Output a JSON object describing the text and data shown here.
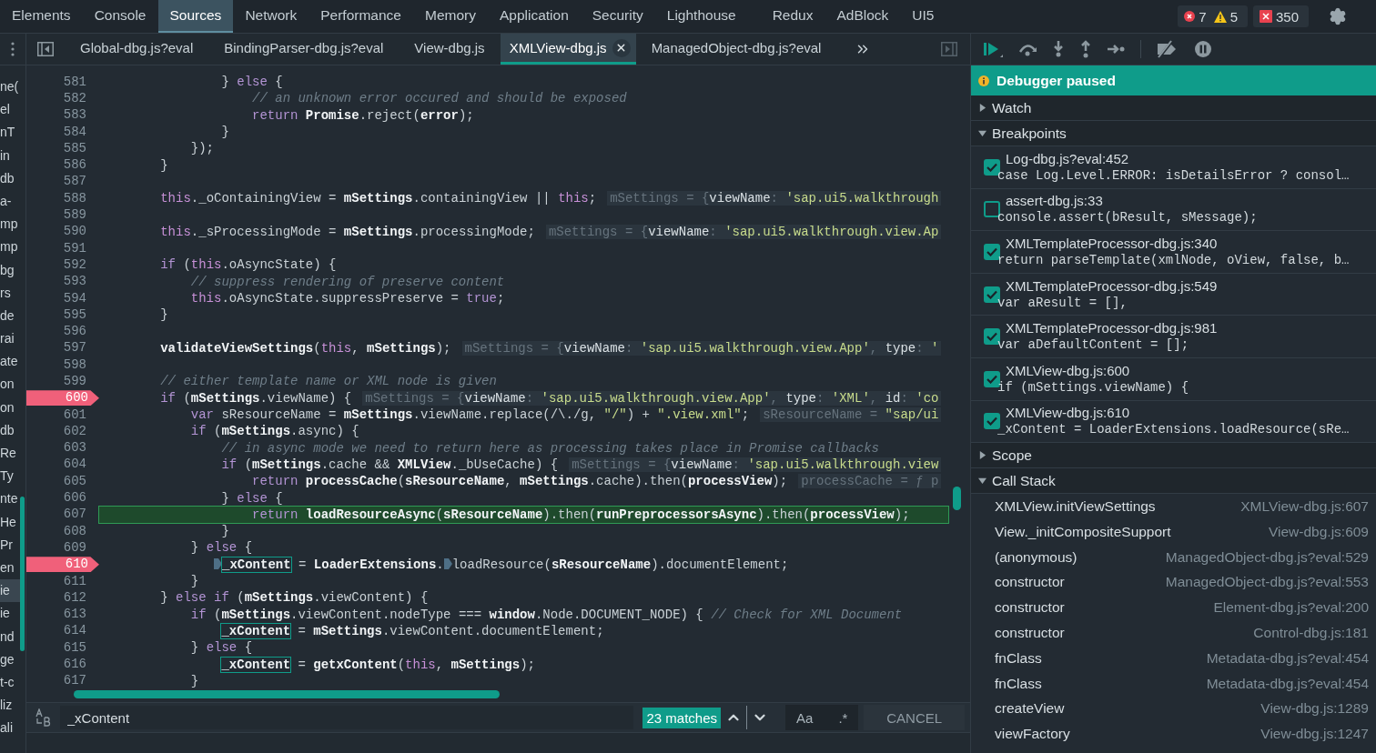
{
  "devtools_tabs": [
    {
      "label": "Elements",
      "selected": false
    },
    {
      "label": "Console",
      "selected": false
    },
    {
      "label": "Sources",
      "selected": true
    },
    {
      "label": "Network",
      "selected": false
    },
    {
      "label": "Performance",
      "selected": false
    },
    {
      "label": "Memory",
      "selected": false
    },
    {
      "label": "Application",
      "selected": false
    },
    {
      "label": "Security",
      "selected": false
    },
    {
      "label": "Lighthouse",
      "selected": false
    },
    {
      "label": "Redux",
      "selected": false
    },
    {
      "label": "AdBlock",
      "selected": false
    },
    {
      "label": "UI5",
      "selected": false
    }
  ],
  "counters": [
    {
      "kind": "error",
      "count": "7"
    },
    {
      "kind": "warning",
      "count": "5"
    },
    {
      "kind": "issue",
      "count": "350"
    }
  ],
  "file_tree": [
    {
      "label": "ne(",
      "selected": false
    },
    {
      "label": "el",
      "selected": false
    },
    {
      "label": "nT",
      "selected": false
    },
    {
      "label": "in",
      "selected": false
    },
    {
      "label": "db",
      "selected": false
    },
    {
      "label": "a-",
      "selected": false
    },
    {
      "label": "mp",
      "selected": false
    },
    {
      "label": "mp",
      "selected": false
    },
    {
      "label": "bg",
      "selected": false
    },
    {
      "label": "rs",
      "selected": false
    },
    {
      "label": "de",
      "selected": false
    },
    {
      "label": "rai",
      "selected": false
    },
    {
      "label": "ate",
      "selected": false
    },
    {
      "label": "on",
      "selected": false
    },
    {
      "label": "on",
      "selected": false
    },
    {
      "label": "db",
      "selected": false
    },
    {
      "label": "Re",
      "selected": false
    },
    {
      "label": "Ty",
      "selected": false
    },
    {
      "label": "nte",
      "selected": false
    },
    {
      "label": "He",
      "selected": false
    },
    {
      "label": "Pr",
      "selected": false
    },
    {
      "label": "en",
      "selected": false
    },
    {
      "label": "ie",
      "selected": true
    },
    {
      "label": "ie",
      "selected": false
    },
    {
      "label": "nd",
      "selected": false
    },
    {
      "label": "ge",
      "selected": false
    },
    {
      "label": "t-c",
      "selected": false
    },
    {
      "label": "liz",
      "selected": false
    },
    {
      "label": "ali",
      "selected": false
    }
  ],
  "editor_tabs": [
    {
      "label": "Global-dbg.js?eval",
      "selected": false
    },
    {
      "label": "BindingParser-dbg.js?eval",
      "selected": false
    },
    {
      "label": "View-dbg.js",
      "selected": false
    },
    {
      "label": "XMLView-dbg.js",
      "selected": true
    },
    {
      "label": "ManagedObject-dbg.js?eval",
      "selected": false
    }
  ],
  "code": {
    "lines": [
      {
        "number": "581",
        "breakpoint": false,
        "current": false,
        "tokens": [
          {
            "kind": "plain",
            "text": "                } "
          },
          {
            "kind": "kw",
            "text": "else"
          },
          {
            "kind": "plain",
            "text": " {"
          }
        ]
      },
      {
        "number": "582",
        "breakpoint": false,
        "current": false,
        "tokens": [
          {
            "kind": "cmt",
            "text": "                    // an unknown error occured and should be exposed"
          }
        ]
      },
      {
        "number": "583",
        "breakpoint": false,
        "current": false,
        "tokens": [
          {
            "kind": "kw",
            "text": "                    return"
          },
          {
            "kind": "bold",
            "text": " Promise"
          },
          {
            "kind": "plain",
            "text": ".reject("
          },
          {
            "kind": "bold",
            "text": "error"
          },
          {
            "kind": "plain",
            "text": ");"
          }
        ]
      },
      {
        "number": "584",
        "breakpoint": false,
        "current": false,
        "tokens": [
          {
            "kind": "plain",
            "text": "                }"
          }
        ]
      },
      {
        "number": "585",
        "breakpoint": false,
        "current": false,
        "tokens": [
          {
            "kind": "plain",
            "text": "            });"
          }
        ]
      },
      {
        "number": "586",
        "breakpoint": false,
        "current": false,
        "tokens": [
          {
            "kind": "plain",
            "text": "        }"
          }
        ]
      },
      {
        "number": "587",
        "breakpoint": false,
        "current": false
      },
      {
        "number": "588",
        "breakpoint": false,
        "current": false,
        "tokens": [
          {
            "kind": "this",
            "text": "        this"
          },
          {
            "kind": "plain",
            "text": "._oContainingView = "
          },
          {
            "kind": "bold",
            "text": "mSettings"
          },
          {
            "kind": "plain",
            "text": ".containingView || "
          },
          {
            "kind": "this",
            "text": "this"
          },
          {
            "kind": "plain",
            "text": ";"
          },
          {
            "kind": "hint",
            "text": "mSettings = {"
          },
          {
            "kind": "hkey",
            "text": "viewName"
          },
          {
            "kind": "hint",
            "text": ": "
          },
          {
            "kind": "hstr",
            "text": "'sap.ui5.walkthrough"
          }
        ]
      },
      {
        "number": "589",
        "breakpoint": false,
        "current": false
      },
      {
        "number": "590",
        "breakpoint": false,
        "current": false,
        "tokens": [
          {
            "kind": "this",
            "text": "        this"
          },
          {
            "kind": "plain",
            "text": "._sProcessingMode = "
          },
          {
            "kind": "bold",
            "text": "mSettings"
          },
          {
            "kind": "plain",
            "text": ".processingMode;"
          },
          {
            "kind": "hint",
            "text": "mSettings = {"
          },
          {
            "kind": "hkey",
            "text": "viewName"
          },
          {
            "kind": "hint",
            "text": ": "
          },
          {
            "kind": "hstr",
            "text": "'sap.ui5.walkthrough.view.Ap"
          }
        ]
      },
      {
        "number": "591",
        "breakpoint": false,
        "current": false
      },
      {
        "number": "592",
        "breakpoint": false,
        "current": false,
        "tokens": [
          {
            "kind": "kw",
            "text": "        if"
          },
          {
            "kind": "plain",
            "text": " ("
          },
          {
            "kind": "this",
            "text": "this"
          },
          {
            "kind": "plain",
            "text": ".oAsyncState) {"
          }
        ]
      },
      {
        "number": "593",
        "breakpoint": false,
        "current": false,
        "tokens": [
          {
            "kind": "cmt",
            "text": "            // suppress rendering of preserve content"
          }
        ]
      },
      {
        "number": "594",
        "breakpoint": false,
        "current": false,
        "tokens": [
          {
            "kind": "this",
            "text": "            this"
          },
          {
            "kind": "plain",
            "text": ".oAsyncState.suppressPreserve = "
          },
          {
            "kind": "kw",
            "text": "true"
          },
          {
            "kind": "plain",
            "text": ";"
          }
        ]
      },
      {
        "number": "595",
        "breakpoint": false,
        "current": false,
        "tokens": [
          {
            "kind": "plain",
            "text": "        }"
          }
        ]
      },
      {
        "number": "596",
        "breakpoint": false,
        "current": false
      },
      {
        "number": "597",
        "breakpoint": false,
        "current": false,
        "tokens": [
          {
            "kind": "bold",
            "text": "        validateViewSettings"
          },
          {
            "kind": "plain",
            "text": "("
          },
          {
            "kind": "this",
            "text": "this"
          },
          {
            "kind": "plain",
            "text": ", "
          },
          {
            "kind": "bold",
            "text": "mSettings"
          },
          {
            "kind": "plain",
            "text": ");"
          },
          {
            "kind": "hint",
            "text": "mSettings = {"
          },
          {
            "kind": "hkey",
            "text": "viewName"
          },
          {
            "kind": "hint",
            "text": ": "
          },
          {
            "kind": "hstr",
            "text": "'sap.ui5.walkthrough.view.App'"
          },
          {
            "kind": "hint",
            "text": ", "
          },
          {
            "kind": "hkey",
            "text": "type"
          },
          {
            "kind": "hint",
            "text": ": "
          },
          {
            "kind": "hstr",
            "text": "'"
          }
        ]
      },
      {
        "number": "598",
        "breakpoint": false,
        "current": false
      },
      {
        "number": "599",
        "breakpoint": false,
        "current": false,
        "tokens": [
          {
            "kind": "cmt",
            "text": "        // either template name or XML node is given"
          }
        ]
      },
      {
        "number": "600",
        "breakpoint": true,
        "current": false,
        "tokens": [
          {
            "kind": "kw",
            "text": "        if"
          },
          {
            "kind": "plain",
            "text": " ("
          },
          {
            "kind": "bold",
            "text": "mSettings"
          },
          {
            "kind": "plain",
            "text": ".viewName) {"
          },
          {
            "kind": "hint",
            "text": "mSettings = {"
          },
          {
            "kind": "hkey",
            "text": "viewName"
          },
          {
            "kind": "hint",
            "text": ": "
          },
          {
            "kind": "hstr",
            "text": "'sap.ui5.walkthrough.view.App'"
          },
          {
            "kind": "hint",
            "text": ", "
          },
          {
            "kind": "hkey",
            "text": "type"
          },
          {
            "kind": "hint",
            "text": ": "
          },
          {
            "kind": "hstr",
            "text": "'XML'"
          },
          {
            "kind": "hint",
            "text": ", "
          },
          {
            "kind": "hkey",
            "text": "id"
          },
          {
            "kind": "hint",
            "text": ": "
          },
          {
            "kind": "hstr",
            "text": "'co"
          }
        ]
      },
      {
        "number": "601",
        "breakpoint": false,
        "current": false,
        "tokens": [
          {
            "kind": "kw",
            "text": "            var"
          },
          {
            "kind": "plain",
            "text": " sResourceName = "
          },
          {
            "kind": "bold",
            "text": "mSettings"
          },
          {
            "kind": "plain",
            "text": ".viewName.replace(/\\./g, "
          },
          {
            "kind": "str",
            "text": "\"/\""
          },
          {
            "kind": "plain",
            "text": ") + "
          },
          {
            "kind": "str",
            "text": "\".view.xml\""
          },
          {
            "kind": "plain",
            "text": ";"
          },
          {
            "kind": "hint",
            "text": "sResourceName = "
          },
          {
            "kind": "hstr",
            "text": "\"sap/ui"
          }
        ]
      },
      {
        "number": "602",
        "breakpoint": false,
        "current": false,
        "tokens": [
          {
            "kind": "kw",
            "text": "            if"
          },
          {
            "kind": "plain",
            "text": " ("
          },
          {
            "kind": "bold",
            "text": "mSettings"
          },
          {
            "kind": "plain",
            "text": ".async) {"
          }
        ]
      },
      {
        "number": "603",
        "breakpoint": false,
        "current": false,
        "tokens": [
          {
            "kind": "cmt",
            "text": "                // in async mode we need to return here as processing takes place in Promise callbacks"
          }
        ]
      },
      {
        "number": "604",
        "breakpoint": false,
        "current": false,
        "tokens": [
          {
            "kind": "kw",
            "text": "                if"
          },
          {
            "kind": "plain",
            "text": " ("
          },
          {
            "kind": "bold",
            "text": "mSettings"
          },
          {
            "kind": "plain",
            "text": ".cache && "
          },
          {
            "kind": "bold",
            "text": "XMLView"
          },
          {
            "kind": "plain",
            "text": "._bUseCache) {"
          },
          {
            "kind": "hint",
            "text": "mSettings = {"
          },
          {
            "kind": "hkey",
            "text": "viewName"
          },
          {
            "kind": "hint",
            "text": ": "
          },
          {
            "kind": "hstr",
            "text": "'sap.ui5.walkthrough.view"
          }
        ]
      },
      {
        "number": "605",
        "breakpoint": false,
        "current": false,
        "tokens": [
          {
            "kind": "kw",
            "text": "                    return"
          },
          {
            "kind": "bold",
            "text": " processCache"
          },
          {
            "kind": "plain",
            "text": "("
          },
          {
            "kind": "bold",
            "text": "sResourceName"
          },
          {
            "kind": "plain",
            "text": ", "
          },
          {
            "kind": "bold",
            "text": "mSettings"
          },
          {
            "kind": "plain",
            "text": ".cache).then("
          },
          {
            "kind": "bold",
            "text": "processView"
          },
          {
            "kind": "plain",
            "text": ");"
          },
          {
            "kind": "hint",
            "text": "processCache = ƒ p"
          }
        ]
      },
      {
        "number": "606",
        "breakpoint": false,
        "current": false,
        "tokens": [
          {
            "kind": "plain",
            "text": "                } "
          },
          {
            "kind": "kw",
            "text": "else"
          },
          {
            "kind": "plain",
            "text": " {"
          }
        ]
      },
      {
        "number": "607",
        "breakpoint": false,
        "current": true,
        "tokens": [
          {
            "kind": "kw",
            "text": "                    return"
          },
          {
            "kind": "bold",
            "text": " loadResourceAsync"
          },
          {
            "kind": "plain",
            "text": "("
          },
          {
            "kind": "bold",
            "text": "sResourceName"
          },
          {
            "kind": "plain",
            "text": ").then("
          },
          {
            "kind": "bold",
            "text": "runPreprocessorsAsync"
          },
          {
            "kind": "plain",
            "text": ").then("
          },
          {
            "kind": "bold",
            "text": "processView"
          },
          {
            "kind": "plain",
            "text": ");"
          }
        ]
      },
      {
        "number": "608",
        "breakpoint": false,
        "current": false,
        "tokens": [
          {
            "kind": "plain",
            "text": "                }"
          }
        ]
      },
      {
        "number": "609",
        "breakpoint": false,
        "current": false,
        "tokens": [
          {
            "kind": "plain",
            "text": "            } "
          },
          {
            "kind": "kw",
            "text": "else"
          },
          {
            "kind": "plain",
            "text": " {"
          }
        ]
      },
      {
        "number": "610",
        "breakpoint": true,
        "current": false,
        "tokens": [
          {
            "kind": "mark"
          },
          {
            "kind": "hl",
            "text": "_xContent"
          },
          {
            "kind": "plain",
            "text": " = "
          },
          {
            "kind": "bold",
            "text": "LoaderExtensions"
          },
          {
            "kind": "plain",
            "text": "."
          },
          {
            "kind": "mark"
          },
          {
            "kind": "plain",
            "text": "loadResource("
          },
          {
            "kind": "bold",
            "text": "sResourceName"
          },
          {
            "kind": "plain",
            "text": ").documentElement;"
          }
        ]
      },
      {
        "number": "611",
        "breakpoint": false,
        "current": false,
        "tokens": [
          {
            "kind": "plain",
            "text": "            }"
          }
        ]
      },
      {
        "number": "612",
        "breakpoint": false,
        "current": false,
        "tokens": [
          {
            "kind": "plain",
            "text": "        } "
          },
          {
            "kind": "kw",
            "text": "else if"
          },
          {
            "kind": "plain",
            "text": " ("
          },
          {
            "kind": "bold",
            "text": "mSettings"
          },
          {
            "kind": "plain",
            "text": ".viewContent) {"
          }
        ]
      },
      {
        "number": "613",
        "breakpoint": false,
        "current": false,
        "tokens": [
          {
            "kind": "kw",
            "text": "            if"
          },
          {
            "kind": "plain",
            "text": " ("
          },
          {
            "kind": "bold",
            "text": "mSettings"
          },
          {
            "kind": "plain",
            "text": ".viewContent.nodeType === "
          },
          {
            "kind": "bold",
            "text": "window"
          },
          {
            "kind": "plain",
            "text": ".Node.DOCUMENT_NODE) { "
          },
          {
            "kind": "cmt",
            "text": "// Check for XML Document"
          }
        ]
      },
      {
        "number": "614",
        "breakpoint": false,
        "current": false,
        "tokens": [
          {
            "kind": "hl",
            "text": "_xContent"
          },
          {
            "kind": "plain",
            "text": " = "
          },
          {
            "kind": "bold",
            "text": "mSettings"
          },
          {
            "kind": "plain",
            "text": ".viewContent.documentElement;"
          }
        ]
      },
      {
        "number": "615",
        "breakpoint": false,
        "current": false,
        "tokens": [
          {
            "kind": "plain",
            "text": "            } "
          },
          {
            "kind": "kw",
            "text": "else"
          },
          {
            "kind": "plain",
            "text": " {"
          }
        ]
      },
      {
        "number": "616",
        "breakpoint": false,
        "current": false,
        "tokens": [
          {
            "kind": "hl",
            "text": "_xContent"
          },
          {
            "kind": "plain",
            "text": " = "
          },
          {
            "kind": "bold",
            "text": "getxContent"
          },
          {
            "kind": "plain",
            "text": "("
          },
          {
            "kind": "this",
            "text": "this"
          },
          {
            "kind": "plain",
            "text": ", "
          },
          {
            "kind": "bold",
            "text": "mSettings"
          },
          {
            "kind": "plain",
            "text": ");"
          }
        ]
      },
      {
        "number": "617",
        "breakpoint": false,
        "current": false,
        "tokens": [
          {
            "kind": "plain",
            "text": "            }"
          }
        ]
      }
    ]
  },
  "search": {
    "value": "_xContent",
    "matches": "23 matches",
    "case_option": "Aa",
    "regex_option": ".*",
    "cancel": "CANCEL"
  },
  "debugger": {
    "banner": "Debugger paused",
    "sections": [
      {
        "kind": "watch",
        "title": "Watch",
        "expanded": false
      },
      {
        "kind": "breakpoints",
        "title": "Breakpoints",
        "expanded": true,
        "items": [
          {
            "location": "Log-dbg.js?eval:452",
            "code": "case Log.Level.ERROR: isDetailsError ? consol…",
            "checked": true
          },
          {
            "location": "assert-dbg.js:33",
            "code": "console.assert(bResult, sMessage);",
            "checked": false
          },
          {
            "location": "XMLTemplateProcessor-dbg.js:340",
            "code": "return parseTemplate(xmlNode, oView, false, b…",
            "checked": true
          },
          {
            "location": "XMLTemplateProcessor-dbg.js:549",
            "code": "var aResult = [],",
            "checked": true
          },
          {
            "location": "XMLTemplateProcessor-dbg.js:981",
            "code": "var aDefaultContent = [];",
            "checked": true
          },
          {
            "location": "XMLView-dbg.js:600",
            "code": "if (mSettings.viewName) {",
            "checked": true
          },
          {
            "location": "XMLView-dbg.js:610",
            "code": "_xContent = LoaderExtensions.loadResource(sRe…",
            "checked": true
          }
        ]
      },
      {
        "kind": "scope",
        "title": "Scope",
        "expanded": false
      },
      {
        "kind": "callstack",
        "title": "Call Stack",
        "expanded": true,
        "frames": [
          {
            "name": "XMLView.initViewSettings",
            "location": "XMLView-dbg.js:607"
          },
          {
            "name": "View._initCompositeSupport",
            "location": "View-dbg.js:609"
          },
          {
            "name": "(anonymous)",
            "location": "ManagedObject-dbg.js?eval:529"
          },
          {
            "name": "constructor",
            "location": "ManagedObject-dbg.js?eval:553"
          },
          {
            "name": "constructor",
            "location": "Element-dbg.js?eval:200"
          },
          {
            "name": "constructor",
            "location": "Control-dbg.js:181"
          },
          {
            "name": "fnClass",
            "location": "Metadata-dbg.js?eval:454"
          },
          {
            "name": "fnClass",
            "location": "Metadata-dbg.js?eval:454"
          },
          {
            "name": "createView",
            "location": "View-dbg.js:1289"
          },
          {
            "name": "viewFactory",
            "location": "View-dbg.js:1247"
          }
        ]
      }
    ]
  }
}
